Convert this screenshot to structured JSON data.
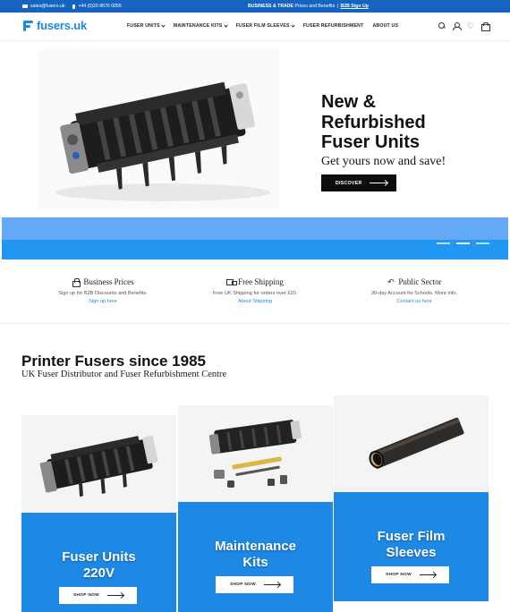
{
  "topbar": {
    "email": "sales@fusers.uk",
    "phone": "+44 (0)20 8676 0055",
    "promo_bold": "BUSINESS & TRADE",
    "promo_text": "Prices and Benefits",
    "promo_sep": "|",
    "promo_link": "B2B Sign Up",
    "bg_color": "#1565c0"
  },
  "header": {
    "logo_text": "fusers.uk",
    "nav": [
      {
        "label": "FUSER UNITS",
        "dropdown": true
      },
      {
        "label": "MAINTENANCE KITS",
        "dropdown": true
      },
      {
        "label": "FUSER FILM SLEEVES",
        "dropdown": true
      },
      {
        "label": "FUSER REFURBISHMENT",
        "dropdown": false
      },
      {
        "label": "ABOUT US",
        "dropdown": false
      }
    ],
    "icons": [
      "search-icon",
      "account-icon",
      "wishlist-icon",
      "cart-icon"
    ]
  },
  "hero": {
    "title_line1": "New &",
    "title_line2": "Refurbished",
    "title_line3": "Fuser Units",
    "subtitle": "Get yours now and save!",
    "cta": "DISCOVER",
    "slides_total": 3,
    "active_slide": 2
  },
  "features": [
    {
      "icon": "lock-icon",
      "title": "Business Prices",
      "desc": "Sign up for B2B Discounts and Benefits.",
      "link": "Sign up here"
    },
    {
      "icon": "truck-icon",
      "title": "Free Shipping",
      "desc": "Free UK Shipping for orders over £20.",
      "link": "About Shipping"
    },
    {
      "icon": "return-icon",
      "title": "Public Sector",
      "desc": "30-day Account for Schools. More info.",
      "link": "Contact us here"
    }
  ],
  "section": {
    "title": "Printer Fusers since 1985",
    "subtitle": "UK Fuser Distributor and Fuser Refurbishment Centre"
  },
  "categories": [
    {
      "title_line1": "Fuser Units",
      "title_line2": "220V",
      "cta": "SHOP NOW"
    },
    {
      "title_line1": "Maintenance",
      "title_line2": "Kits",
      "cta": "SHOP NOW"
    },
    {
      "title_line1": "Fuser Film",
      "title_line2": "Sleeves",
      "cta": "SHOP NOW"
    }
  ],
  "colors": {
    "brand_blue": "#1e88e5",
    "dark_blue": "#1565c0",
    "black_button": "#0d0d0d"
  }
}
